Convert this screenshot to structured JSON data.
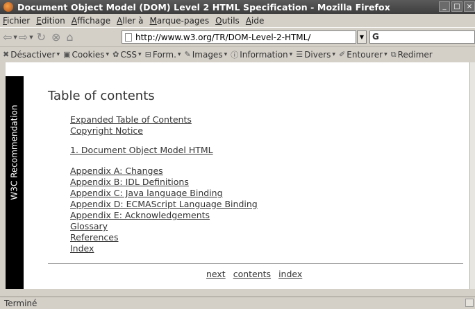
{
  "window": {
    "title": "Document Object Model (DOM) Level 2 HTML Specification - Mozilla Firefox"
  },
  "menu": {
    "items": [
      "Fichier",
      "Edition",
      "Affichage",
      "Aller à",
      "Marque-pages",
      "Outils",
      "Aide"
    ]
  },
  "nav": {
    "url": "http://www.w3.org/TR/DOM-Level-2-HTML/",
    "search_value": "G"
  },
  "webdev_toolbar": {
    "items": [
      "Désactiver",
      "Cookies",
      "CSS",
      "Form.",
      "Images",
      "Information",
      "Divers",
      "Entourer",
      "Redimer"
    ]
  },
  "sidetab": {
    "label": "W3C Recommendation"
  },
  "toc": {
    "heading": "Table of contents",
    "links": [
      "Expanded Table of Contents",
      "Copyright Notice",
      "1. Document Object Model HTML",
      "Appendix A: Changes",
      "Appendix B: IDL Definitions",
      "Appendix C: Java language Binding",
      "Appendix D: ECMAScript Language Binding",
      "Appendix E: Acknowledgements",
      "Glossary",
      "References",
      "Index"
    ]
  },
  "footer_nav": {
    "next": "next",
    "contents": "contents",
    "index": "index"
  },
  "status": {
    "text": "Terminé"
  }
}
